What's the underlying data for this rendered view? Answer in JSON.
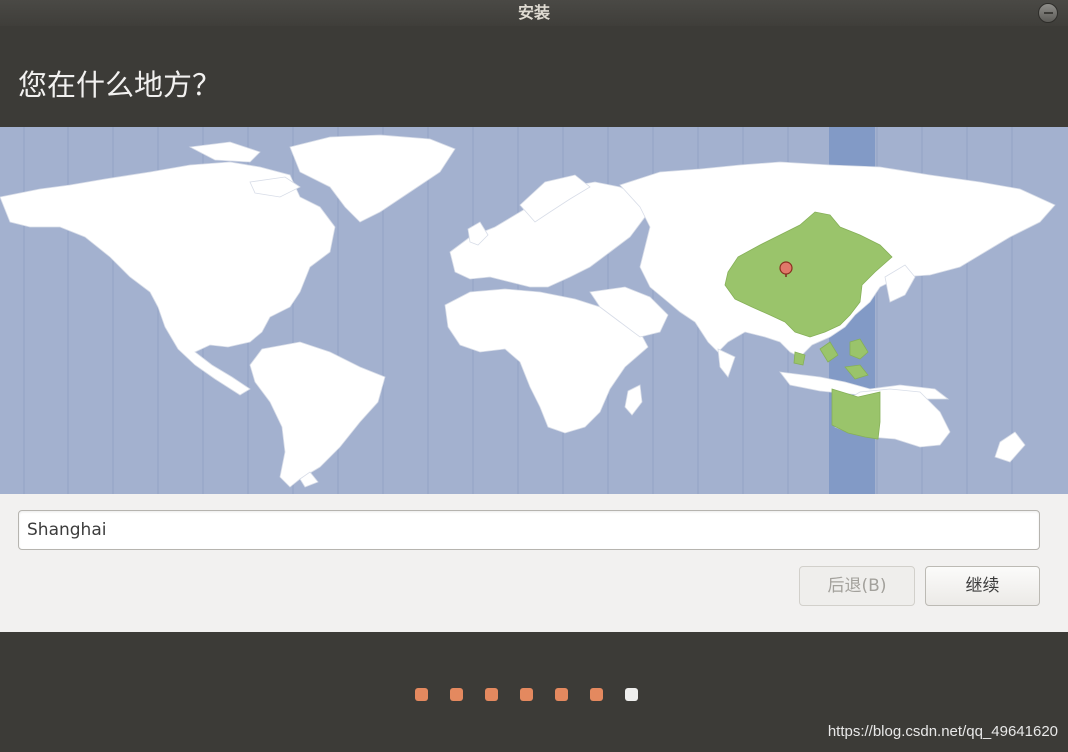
{
  "window": {
    "title": "安装"
  },
  "page": {
    "title": "您在什么地方？"
  },
  "map": {
    "selected_city": "Shanghai",
    "ocean_color": "#a3b1cf",
    "land_color": "#ffffff",
    "highlight_color": "#9ac46b",
    "timezone_band_color": "#7d96c4"
  },
  "location_input": {
    "value": "Shanghai"
  },
  "buttons": {
    "back_label": "后退(B)",
    "continue_label": "继续"
  },
  "progress": {
    "total_steps": 7,
    "current_step": 7
  },
  "watermark": "https://blog.csdn.net/qq_49641620"
}
